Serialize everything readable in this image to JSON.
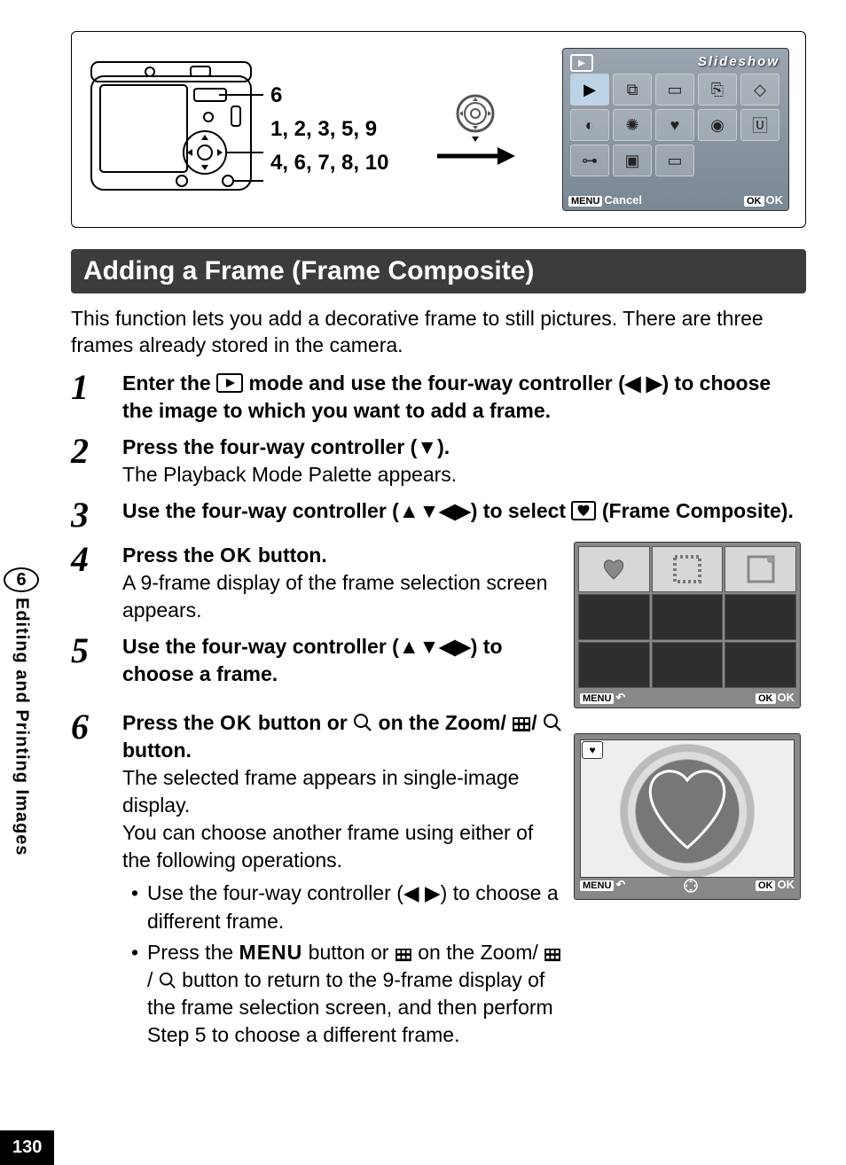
{
  "page_number": "130",
  "side_tab": {
    "chapter_num": "6",
    "label": "Editing and Printing Images"
  },
  "top_figure": {
    "callouts": [
      "6",
      "1, 2, 3, 5, 9",
      "4, 6, 7, 8, 10"
    ],
    "lcd": {
      "title": "Slideshow",
      "menu_label": "MENU",
      "cancel_label": "Cancel",
      "ok_box": "OK",
      "ok_label": "OK"
    }
  },
  "section_title": "Adding a Frame (Frame Composite)",
  "intro": "This function lets you add a decorative frame to still pictures. There are three frames already stored in the camera.",
  "steps": {
    "s1": {
      "num": "1",
      "head_a": "Enter the ",
      "head_b": " mode and use the four-way controller (◀ ▶) to choose the image to which you want to add a frame."
    },
    "s2": {
      "num": "2",
      "head": "Press the four-way controller (▼).",
      "sub": "The Playback Mode Palette appears."
    },
    "s3": {
      "num": "3",
      "head_a": "Use the four-way controller (▲▼◀▶) to select ",
      "head_b": " (Frame Composite)."
    },
    "s4": {
      "num": "4",
      "head_a": "Press the ",
      "head_ok": "OK",
      "head_b": " button.",
      "sub": "A 9-frame display of the frame selection screen appears."
    },
    "s5": {
      "num": "5",
      "head": "Use the four-way controller (▲▼◀▶) to choose a frame."
    },
    "s6": {
      "num": "6",
      "head_a": "Press the ",
      "head_ok": "OK",
      "head_b": " button or ",
      "head_c": " on the Zoom/",
      "head_d": " button.",
      "sub_a": "The selected frame appears in single-image display.",
      "sub_b": "You can choose another frame using either of the following operations.",
      "bullet1": "Use the four-way controller (◀ ▶) to choose a different frame.",
      "bullet2_a": "Press the ",
      "bullet2_menu": "MENU",
      "bullet2_b": " button or ",
      "bullet2_c": " on the Zoom/",
      "bullet2_d": " button to return to the 9-frame display of the frame selection screen, and then perform Step 5 to choose a different frame."
    }
  },
  "mini_lcd": {
    "menu_box": "MENU",
    "ok_box": "OK",
    "ok_label": "OK"
  }
}
